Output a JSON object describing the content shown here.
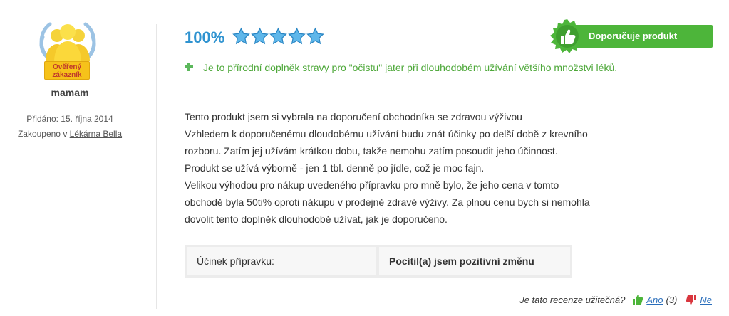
{
  "reviewer": {
    "badge_line1": "Ověřený",
    "badge_line2": "zákazník",
    "username": "mamam",
    "added": "Přidáno: 15. října 2014",
    "bought_prefix": "Zakoupeno v ",
    "bought_store": "Lékárna Bella"
  },
  "review": {
    "rating_percent": "100%",
    "stars": 5,
    "recommend_label": "Doporučuje produkt",
    "pro_text": "Je to přírodní doplněk stravy pro \"očistu\" jater při dlouhodobém užívání většího množstvi léků.",
    "body_lines": [
      "Tento produkt jsem si vybrala na doporučení obchodníka se zdravou výživou",
      "Vzhledem k doporučenému dloudobému užívání budu znát účinky po delší době z krevního",
      "rozboru. Zatím jej užívám krátkou dobu, takže nemohu zatím posoudit jeho účinnost.",
      "Produkt se užívá výborně - jen 1 tbl. denně po jídle, což je moc fajn.",
      "Velikou výhodou pro nákup uvedeného přípravku pro mně bylo, že jeho cena v tomto",
      "obchodě byla 50ti% oproti nákupu v prodejně zdravé výživy. Za plnou cenu bych si nemohla",
      "dovolit tento doplněk dlouhodobě užívat, jak je doporučeno."
    ],
    "effect_label": "Účinek přípravku:",
    "effect_value": "Pocítil(a) jsem pozitivní změnu"
  },
  "helpful": {
    "question": "Je tato recenze užitečná?",
    "yes_label": "Ano",
    "yes_count": "(3)",
    "no_label": "Ne"
  },
  "colors": {
    "accent_blue": "#2f93d0",
    "green": "#4db53a",
    "pro_green": "#4ea83a",
    "badge_gold": "#f6c21a"
  }
}
